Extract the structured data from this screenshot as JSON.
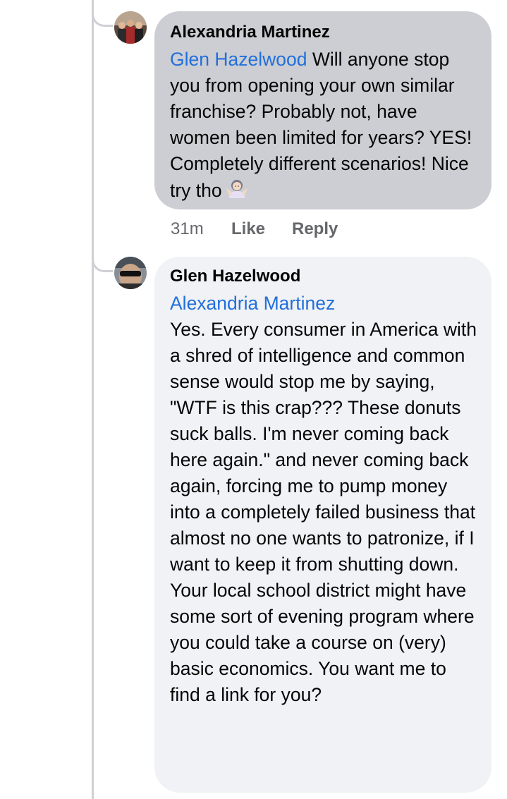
{
  "comment1": {
    "author": "Alexandria Martinez",
    "mention": "Glen Hazelwood",
    "text": " Will anyone stop you from opening your own similar franchise? Probably not, have women been limited for years? YES! Completely different scenarios! Nice try tho",
    "emoji_icon": "person-shrugging-emoji-icon",
    "time": "31m",
    "like_label": "Like",
    "reply_label": "Reply"
  },
  "comment2": {
    "author": "Glen Hazelwood",
    "mention": "Alexandria Martinez",
    "text": "Yes. Every consumer in America with a shred of intelligence and common sense would stop me by saying, \"WTF is this crap??? These donuts suck balls. I'm never coming back here again.\" and never coming back again, forcing me to pump money into a completely failed business that almost no one wants to patronize, if I want to keep it from shutting down.\nYour local school district might have some sort of evening program where you could take a course on (very) basic economics. You want me to find a link for you?"
  },
  "colors": {
    "mention": "#216fdb",
    "bubble_reply": "#ccced3",
    "bubble_main": "#f0f2f5",
    "meta_text": "#65676b",
    "thread_line": "#ced0d4"
  }
}
